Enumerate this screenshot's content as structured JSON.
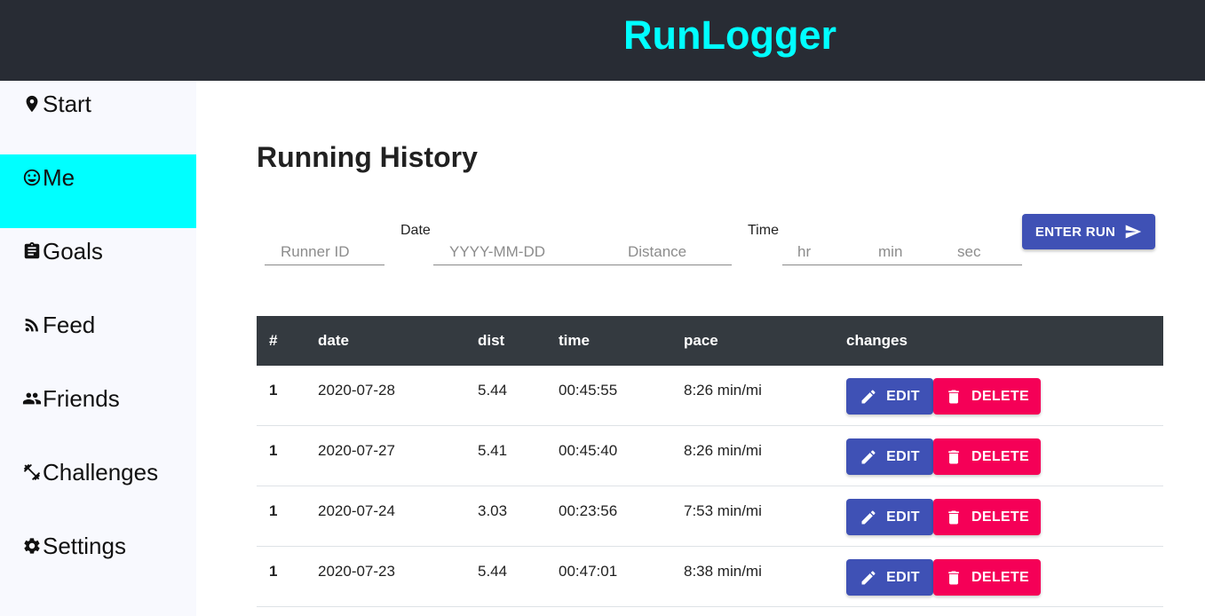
{
  "header": {
    "brand": "RunLogger"
  },
  "sidebar": {
    "items": [
      {
        "label": "Start",
        "icon": "location-pin-icon"
      },
      {
        "label": "Me",
        "icon": "smiley-face-icon",
        "active": true
      },
      {
        "label": "Goals",
        "icon": "clipboard-icon"
      },
      {
        "label": "Feed",
        "icon": "rss-feed-icon"
      },
      {
        "label": "Friends",
        "icon": "people-icon"
      },
      {
        "label": "Challenges",
        "icon": "dumbbell-icon"
      },
      {
        "label": "Settings",
        "icon": "gear-icon"
      }
    ]
  },
  "colors": {
    "brand": "#00ffff",
    "topbar": "#282c34",
    "active_nav": "#00ffff",
    "primary": "#3f51b5",
    "danger": "#f50057",
    "table_header": "#343a40"
  },
  "main": {
    "title": "Running History",
    "form": {
      "runner_id_placeholder": "Runner ID",
      "date_label": "Date",
      "date_placeholder": "YYYY-MM-DD",
      "distance_placeholder": "Distance",
      "time_label": "Time",
      "hr_placeholder": "hr",
      "min_placeholder": "min",
      "sec_placeholder": "sec",
      "enter_button": "ENTER RUN"
    },
    "table": {
      "headers": [
        "#",
        "date",
        "dist",
        "time",
        "pace",
        "changes"
      ],
      "edit_label": "EDIT",
      "delete_label": "DELETE",
      "rows": [
        {
          "num": "1",
          "date": "2020-07-28",
          "dist": "5.44",
          "time": "00:45:55",
          "pace": "8:26 min/mi"
        },
        {
          "num": "1",
          "date": "2020-07-27",
          "dist": "5.41",
          "time": "00:45:40",
          "pace": "8:26 min/mi"
        },
        {
          "num": "1",
          "date": "2020-07-24",
          "dist": "3.03",
          "time": "00:23:56",
          "pace": "7:53 min/mi"
        },
        {
          "num": "1",
          "date": "2020-07-23",
          "dist": "5.44",
          "time": "00:47:01",
          "pace": "8:38 min/mi"
        }
      ]
    }
  }
}
